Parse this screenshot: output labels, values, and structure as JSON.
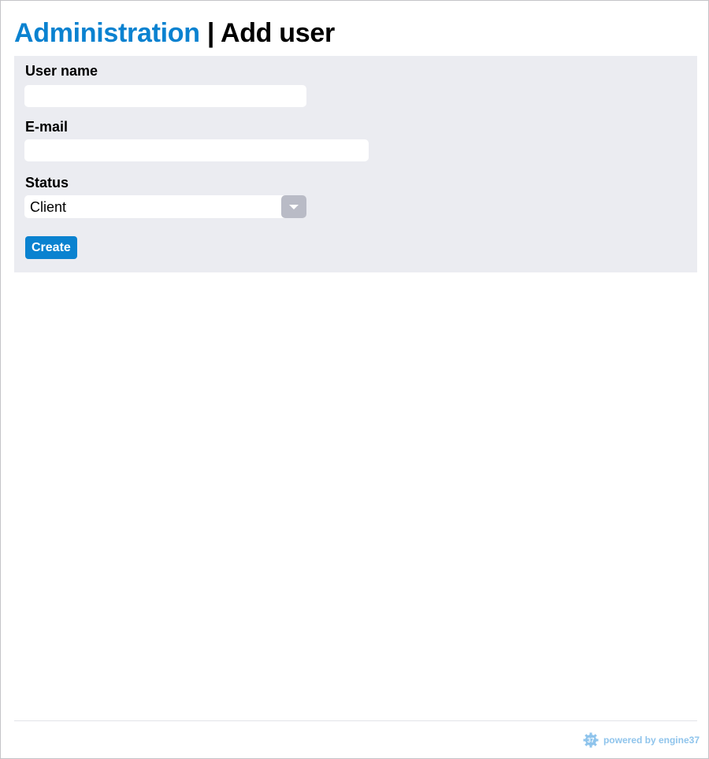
{
  "header": {
    "section": "Administration",
    "separator": " | ",
    "page_title": "Add user"
  },
  "form": {
    "username_label": "User name",
    "username_value": "",
    "email_label": "E-mail",
    "email_value": "",
    "status_label": "Status",
    "status_selected": "Client",
    "create_label": "Create"
  },
  "footer": {
    "logo_text": "37",
    "powered_by": "powered by engine37"
  },
  "colors": {
    "accent": "#0a82d0",
    "panel_bg": "#ebecf1",
    "select_arrow_bg": "#b9bbc6",
    "footer_text": "#8fc4ec"
  },
  "icons": {
    "select_arrow": "chevron-down-icon",
    "footer_logo": "gear-icon"
  }
}
